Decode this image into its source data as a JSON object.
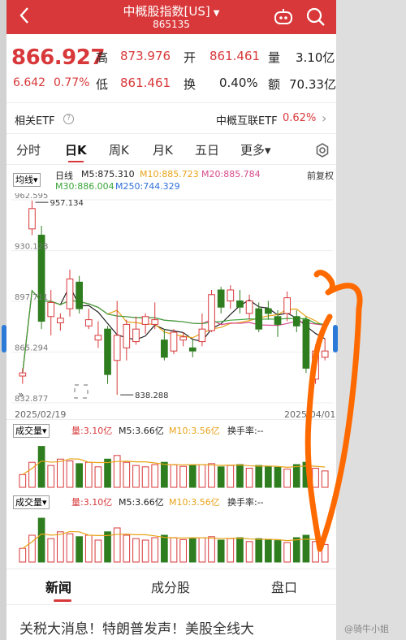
{
  "header": {
    "title": "中概股指数[US]",
    "dropdown": "▼",
    "code": "865135",
    "back_icon": "chevron-left-icon",
    "robot_icon": "assistant-robot-icon",
    "search_icon": "search-icon"
  },
  "quote": {
    "price": "866.927",
    "change": "6.642",
    "change_pct": "0.77%",
    "high_label": "高",
    "high": "873.976",
    "open_label": "开",
    "open": "861.461",
    "volume_label": "量",
    "volume": "3.10亿",
    "low_label": "低",
    "low": "861.461",
    "turnover_label": "换",
    "turnover": "0.40%",
    "amount_label": "额",
    "amount": "70.33亿"
  },
  "etf": {
    "label": "相关ETF",
    "help": "?",
    "name": "中概互联ETF",
    "pct": "0.62%",
    "arrow": "›"
  },
  "tabs": [
    "分时",
    "日K",
    "周K",
    "月K",
    "五日",
    "更多▾"
  ],
  "active_tab": "日K",
  "settings_icon": "gear-icon",
  "ma": {
    "selector": "均线▾",
    "line_label": "日线",
    "m5": "M5:875.310",
    "m10": "M10:885.723",
    "m20": "M20:885.784",
    "m30": "M30:886.004",
    "m250": "M250:744.329",
    "adjust": "前复权"
  },
  "axis": {
    "y_labels": [
      "962.595",
      "930.128",
      "897.711",
      "865.294",
      "832.877"
    ],
    "annot_high": "957.134",
    "annot_low": "838.288",
    "date_start": "2025/02/19",
    "date_end": "2025/04/01"
  },
  "volume_panels": [
    {
      "label": "成交量▾",
      "vol": "量:3.10亿",
      "m5": "M5:3.66亿",
      "m10": "M10:3.56亿",
      "turn": "换手率:--"
    },
    {
      "label": "成交量▾",
      "vol": "量:3.10亿",
      "m5": "M5:3.66亿",
      "m10": "M10:3.56亿",
      "turn": "换手率:--"
    }
  ],
  "bottom_tabs": [
    "新闻",
    "成分股",
    "盘口"
  ],
  "news_headline": "关税大消息！特朗普发声！美股全线大",
  "watermark": "@骑牛小姐",
  "colors": {
    "up": "#d8383a",
    "down": "#2e7d1f",
    "m5": "#222222",
    "m10": "#e8a317",
    "m20": "#d84a8a",
    "m30": "#3aa53a",
    "m250": "#2f6fd8",
    "annotation": "#ff6a00"
  },
  "chart_data": {
    "type": "candlestick",
    "ylim": [
      832.877,
      962.595
    ],
    "candles": [
      {
        "o": 850,
        "h": 855,
        "l": 845,
        "c": 852
      },
      {
        "o": 944,
        "h": 962,
        "l": 940,
        "c": 957
      },
      {
        "o": 940,
        "h": 946,
        "l": 880,
        "c": 885
      },
      {
        "o": 888,
        "h": 905,
        "l": 876,
        "c": 897
      },
      {
        "o": 884,
        "h": 890,
        "l": 879,
        "c": 887
      },
      {
        "o": 893,
        "h": 918,
        "l": 888,
        "c": 912
      },
      {
        "o": 910,
        "h": 914,
        "l": 890,
        "c": 893
      },
      {
        "o": 882,
        "h": 893,
        "l": 880,
        "c": 886
      },
      {
        "o": 873,
        "h": 885,
        "l": 868,
        "c": 876
      },
      {
        "o": 880,
        "h": 882,
        "l": 845,
        "c": 851
      },
      {
        "o": 860,
        "h": 898,
        "l": 838,
        "c": 876
      },
      {
        "o": 868,
        "h": 886,
        "l": 860,
        "c": 883
      },
      {
        "o": 872,
        "h": 888,
        "l": 870,
        "c": 880
      },
      {
        "o": 883,
        "h": 890,
        "l": 877,
        "c": 888
      },
      {
        "o": 883,
        "h": 897,
        "l": 880,
        "c": 886
      },
      {
        "o": 873,
        "h": 880,
        "l": 860,
        "c": 862
      },
      {
        "o": 866,
        "h": 880,
        "l": 864,
        "c": 878
      },
      {
        "o": 873,
        "h": 878,
        "l": 869,
        "c": 875
      },
      {
        "o": 868,
        "h": 873,
        "l": 862,
        "c": 866
      },
      {
        "o": 872,
        "h": 890,
        "l": 869,
        "c": 880
      },
      {
        "o": 879,
        "h": 905,
        "l": 878,
        "c": 902
      },
      {
        "o": 905,
        "h": 907,
        "l": 890,
        "c": 894
      },
      {
        "o": 898,
        "h": 908,
        "l": 893,
        "c": 905
      },
      {
        "o": 898,
        "h": 905,
        "l": 890,
        "c": 894
      },
      {
        "o": 890,
        "h": 902,
        "l": 886,
        "c": 898
      },
      {
        "o": 893,
        "h": 897,
        "l": 878,
        "c": 880
      },
      {
        "o": 893,
        "h": 898,
        "l": 886,
        "c": 890
      },
      {
        "o": 888,
        "h": 892,
        "l": 875,
        "c": 883
      },
      {
        "o": 890,
        "h": 904,
        "l": 885,
        "c": 900
      },
      {
        "o": 888,
        "h": 892,
        "l": 878,
        "c": 882
      },
      {
        "o": 886,
        "h": 888,
        "l": 852,
        "c": 855
      },
      {
        "o": 848,
        "h": 870,
        "l": 845,
        "c": 866
      },
      {
        "o": 862,
        "h": 874,
        "l": 860,
        "c": 866
      }
    ],
    "volume_fractions": [
      0.28,
      0.55,
      0.9,
      0.48,
      0.62,
      0.58,
      0.52,
      0.55,
      0.45,
      0.62,
      0.7,
      0.55,
      0.48,
      0.45,
      0.5,
      0.55,
      0.5,
      0.46,
      0.48,
      0.5,
      0.52,
      0.45,
      0.48,
      0.5,
      0.42,
      0.48,
      0.46,
      0.44,
      0.4,
      0.5,
      0.55,
      0.42,
      0.36
    ]
  }
}
